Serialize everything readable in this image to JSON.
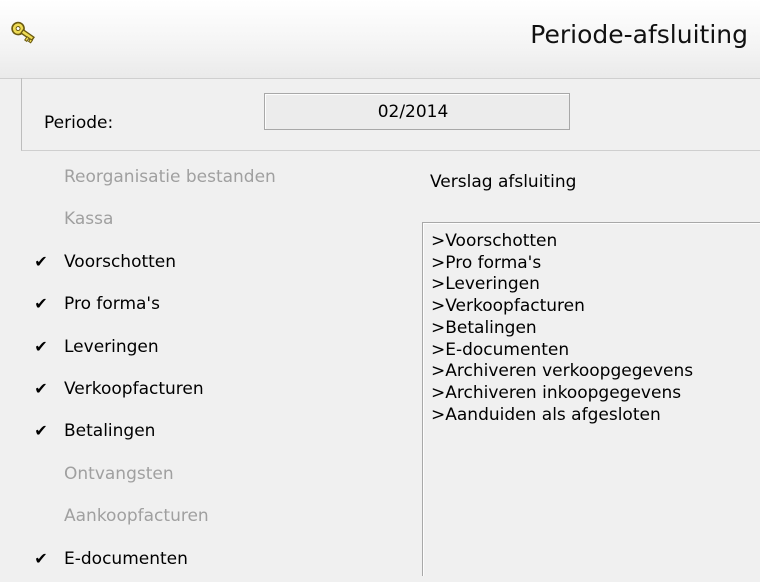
{
  "window": {
    "title": "Periode-afsluiting",
    "icon": "key-icon"
  },
  "periode": {
    "label": "Periode:",
    "value": "02/2014"
  },
  "steps": [
    {
      "label": "Reorganisatie bestanden",
      "checked": false,
      "enabled": false
    },
    {
      "label": "Kassa",
      "checked": false,
      "enabled": false
    },
    {
      "label": "Voorschotten",
      "checked": true,
      "enabled": true
    },
    {
      "label": "Pro forma's",
      "checked": true,
      "enabled": true
    },
    {
      "label": "Leveringen",
      "checked": true,
      "enabled": true
    },
    {
      "label": "Verkoopfacturen",
      "checked": true,
      "enabled": true
    },
    {
      "label": "Betalingen",
      "checked": true,
      "enabled": true
    },
    {
      "label": "Ontvangsten",
      "checked": false,
      "enabled": false
    },
    {
      "label": "Aankoopfacturen",
      "checked": false,
      "enabled": false
    },
    {
      "label": "E-documenten",
      "checked": true,
      "enabled": true
    }
  ],
  "checkmark": "✔",
  "verslag": {
    "label": "Verslag afsluiting",
    "lines": [
      ">Voorschotten",
      ">Pro forma's",
      ">Leveringen",
      ">Verkoopfacturen",
      ">Betalingen",
      ">E-documenten",
      ">Archiveren verkoopgegevens",
      ">Archiveren inkoopgegevens",
      ">Aanduiden als afgesloten"
    ]
  },
  "colors": {
    "disabled_text": "#a0a0a0",
    "key_icon": "#e8d44d"
  }
}
